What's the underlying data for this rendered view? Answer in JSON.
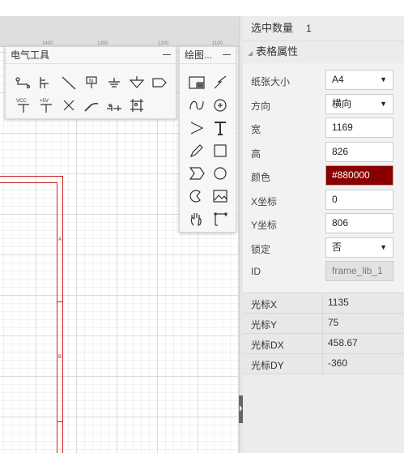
{
  "app": {
    "title": ""
  },
  "ruler": {
    "ticks": [
      "1400",
      "1300",
      "1200",
      "1100"
    ]
  },
  "electric_palette": {
    "title": "电气工具",
    "tools": [
      {
        "name": "pin-tool-icon",
        "type": "pin"
      },
      {
        "name": "net-label-tool-icon",
        "type": "netlabel"
      },
      {
        "name": "wire-tool-icon",
        "type": "wire"
      },
      {
        "name": "netflag-tool-icon",
        "type": "netflag",
        "text": "N"
      },
      {
        "name": "ground-tool-icon",
        "type": "ground"
      },
      {
        "name": "signal-ground-tool-icon",
        "type": "sground"
      },
      {
        "name": "net-port-tool-icon",
        "type": "port"
      },
      {
        "name": "vcc-tool-icon",
        "type": "vcc",
        "text": "VCC"
      },
      {
        "name": "plus5v-tool-icon",
        "type": "plus5v",
        "text": "+5V"
      },
      {
        "name": "no-connect-tool-icon",
        "type": "noconnect"
      },
      {
        "name": "bus-tool-icon",
        "type": "bus"
      },
      {
        "name": "bus-entry-tool-icon",
        "type": "busentry"
      },
      {
        "name": "group-tool-icon",
        "type": "group"
      }
    ]
  },
  "draw_palette": {
    "title": "绘图...",
    "tools": [
      {
        "name": "frame-tool-icon",
        "type": "frame"
      },
      {
        "name": "line-draw-tool-icon",
        "type": "zigzag"
      },
      {
        "name": "bezier-tool-icon",
        "type": "bezier"
      },
      {
        "name": "arc-tool-icon",
        "type": "arc"
      },
      {
        "name": "arrow-tool-icon",
        "type": "arrow"
      },
      {
        "name": "text-tool-icon",
        "type": "text"
      },
      {
        "name": "freehand-tool-icon",
        "type": "pencil"
      },
      {
        "name": "rectangle-tool-icon",
        "type": "rect"
      },
      {
        "name": "polygon-tool-icon",
        "type": "polygon"
      },
      {
        "name": "circle-tool-icon",
        "type": "circle"
      },
      {
        "name": "pie-tool-icon",
        "type": "pie"
      },
      {
        "name": "image-tool-icon",
        "type": "image"
      },
      {
        "name": "pan-tool-icon",
        "type": "hand"
      },
      {
        "name": "drag-tool-icon",
        "type": "drag"
      }
    ]
  },
  "frame": {
    "zone_labels": [
      "A",
      "B"
    ]
  },
  "panel": {
    "selected_label": "选中数量",
    "selected_count": "1",
    "section_title": "表格属性",
    "props": [
      {
        "key": "paper_size",
        "label": "纸张大小",
        "value": "A4",
        "kind": "select"
      },
      {
        "key": "orientation",
        "label": "方向",
        "value": "横向",
        "kind": "select"
      },
      {
        "key": "width",
        "label": "宽",
        "value": "1169",
        "kind": "input"
      },
      {
        "key": "height",
        "label": "高",
        "value": "826",
        "kind": "input"
      },
      {
        "key": "color",
        "label": "颜色",
        "value": "#880000",
        "kind": "color"
      },
      {
        "key": "x",
        "label": "X坐标",
        "value": "0",
        "kind": "input"
      },
      {
        "key": "y",
        "label": "Y坐标",
        "value": "806",
        "kind": "input"
      },
      {
        "key": "lock",
        "label": "锁定",
        "value": "否",
        "kind": "select"
      },
      {
        "key": "id",
        "label": "ID",
        "value": "frame_lib_1",
        "kind": "disabled"
      }
    ],
    "mouse": [
      {
        "label": "光标X",
        "value": "1135"
      },
      {
        "label": "光标Y",
        "value": "75"
      },
      {
        "label": "光标DX",
        "value": "458.67"
      },
      {
        "label": "光标DY",
        "value": "-360"
      }
    ]
  },
  "colors": {
    "frame": "#d02020",
    "accent_dark_red": "#880000"
  }
}
